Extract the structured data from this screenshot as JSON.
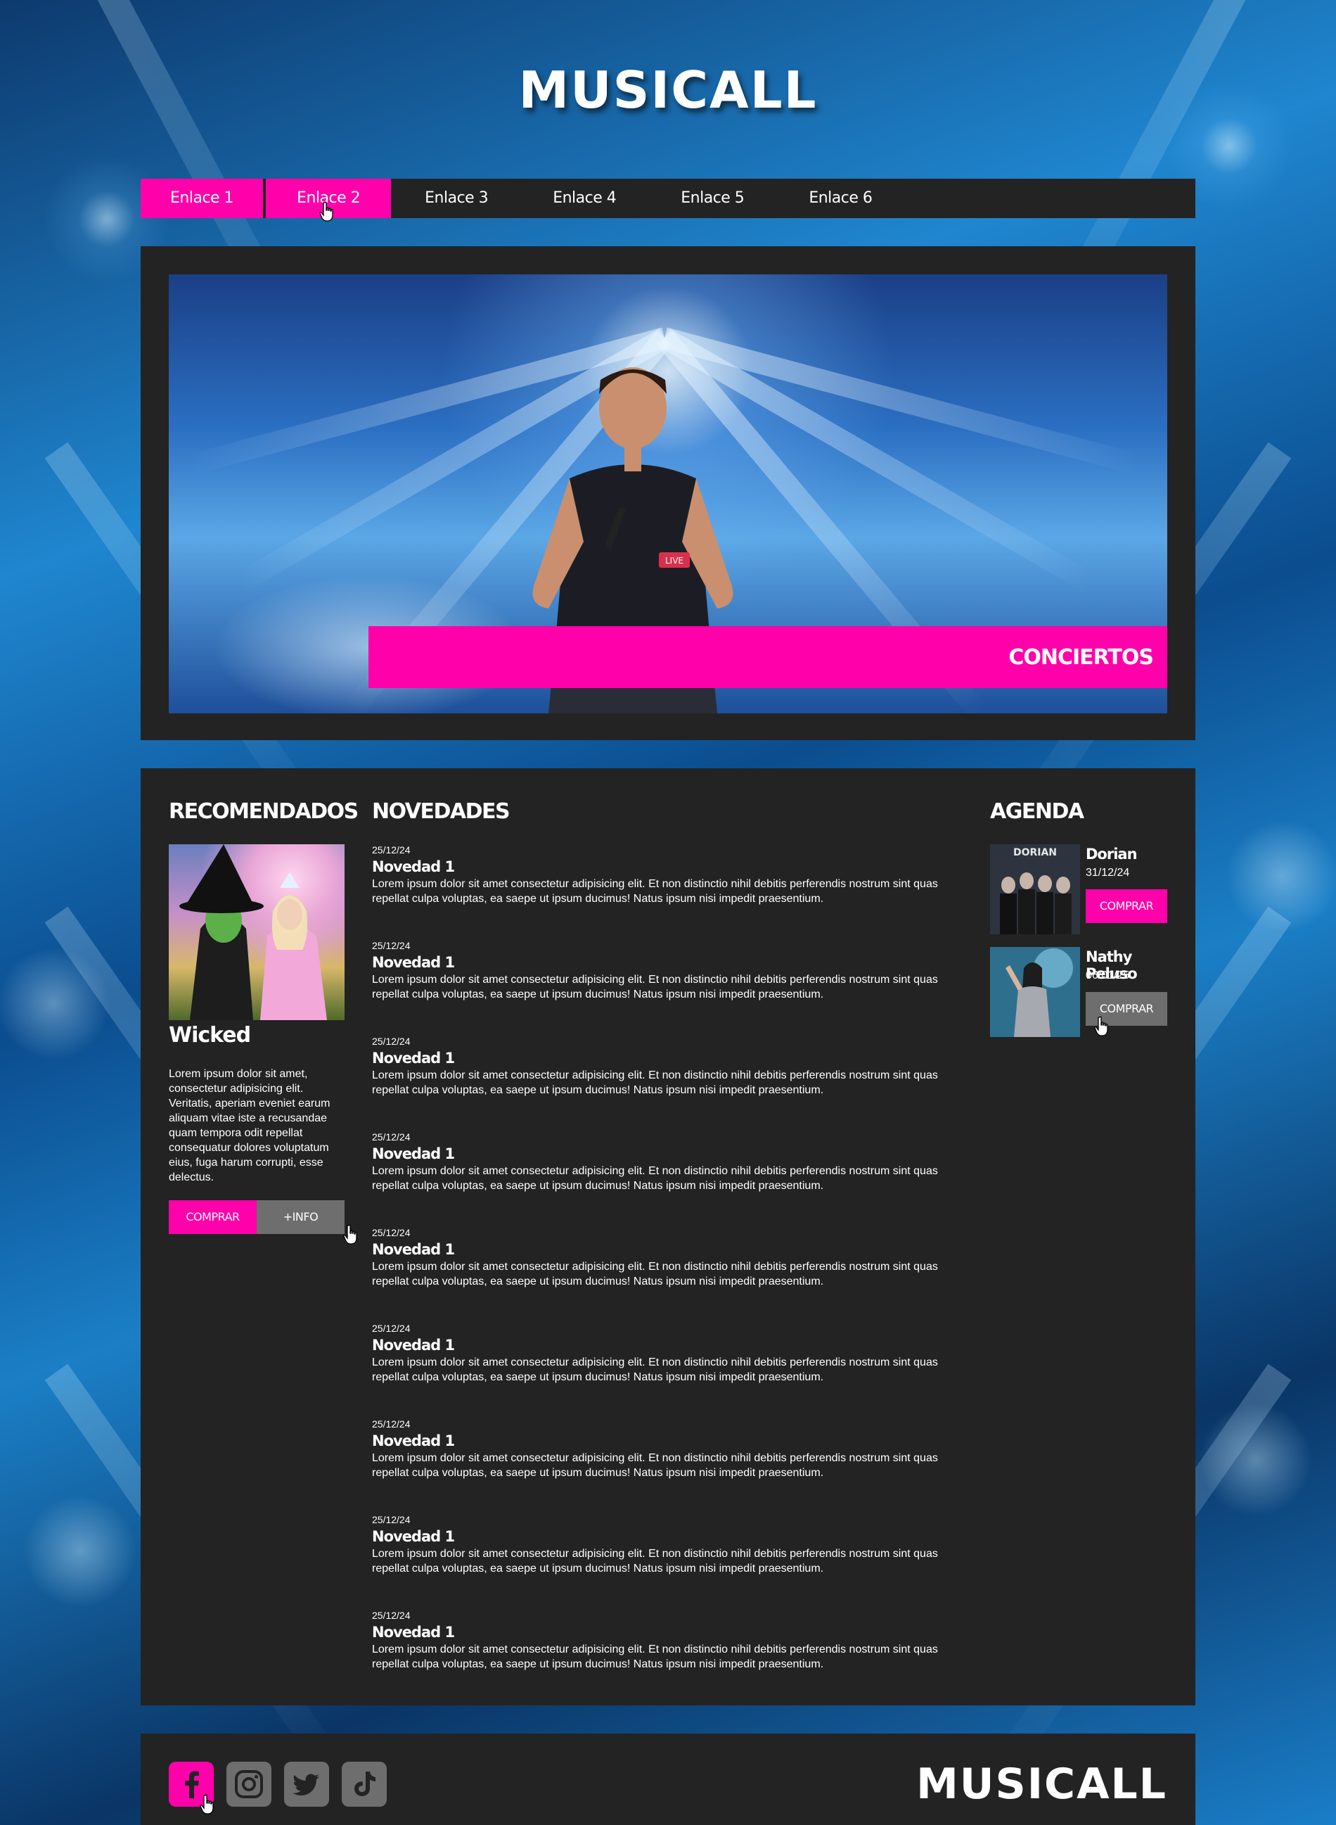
{
  "site": {
    "logo": "MUSICALL"
  },
  "nav": {
    "items": [
      {
        "label": "Enlace 1"
      },
      {
        "label": "Enlace 2"
      },
      {
        "label": "Enlace 3"
      },
      {
        "label": "Enlace 4"
      },
      {
        "label": "Enlace 5"
      },
      {
        "label": "Enlace 6"
      }
    ]
  },
  "hero": {
    "banner_label": "CONCIERTOS",
    "sign_text": "LIVE"
  },
  "recomendados": {
    "title": "RECOMENDADOS",
    "item": {
      "title": "Wicked",
      "description": "Lorem ipsum dolor sit amet, consectetur adipisicing elit. Veritatis, aperiam eveniet earum aliquam vitae iste a recusandae quam tempora odit repellat consequatur dolores voluptatum eius, fuga harum corrupti, esse delectus.",
      "buy_label": "COMPRAR",
      "info_label": "+INFO"
    }
  },
  "novedades": {
    "title": "NOVEDADES",
    "items": [
      {
        "date": "25/12/24",
        "title": "Novedad 1",
        "body": "Lorem ipsum dolor sit amet consectetur adipisicing elit. Et non distinctio nihil debitis perferendis nostrum sint quas repellat culpa voluptas, ea saepe ut ipsum ducimus! Natus ipsum nisi impedit praesentium."
      },
      {
        "date": "25/12/24",
        "title": "Novedad 1",
        "body": "Lorem ipsum dolor sit amet consectetur adipisicing elit. Et non distinctio nihil debitis perferendis nostrum sint quas repellat culpa voluptas, ea saepe ut ipsum ducimus! Natus ipsum nisi impedit praesentium."
      },
      {
        "date": "25/12/24",
        "title": "Novedad 1",
        "body": "Lorem ipsum dolor sit amet consectetur adipisicing elit. Et non distinctio nihil debitis perferendis nostrum sint quas repellat culpa voluptas, ea saepe ut ipsum ducimus! Natus ipsum nisi impedit praesentium."
      },
      {
        "date": "25/12/24",
        "title": "Novedad 1",
        "body": "Lorem ipsum dolor sit amet consectetur adipisicing elit. Et non distinctio nihil debitis perferendis nostrum sint quas repellat culpa voluptas, ea saepe ut ipsum ducimus! Natus ipsum nisi impedit praesentium."
      },
      {
        "date": "25/12/24",
        "title": "Novedad 1",
        "body": "Lorem ipsum dolor sit amet consectetur adipisicing elit. Et non distinctio nihil debitis perferendis nostrum sint quas repellat culpa voluptas, ea saepe ut ipsum ducimus! Natus ipsum nisi impedit praesentium."
      },
      {
        "date": "25/12/24",
        "title": "Novedad 1",
        "body": "Lorem ipsum dolor sit amet consectetur adipisicing elit. Et non distinctio nihil debitis perferendis nostrum sint quas repellat culpa voluptas, ea saepe ut ipsum ducimus! Natus ipsum nisi impedit praesentium."
      },
      {
        "date": "25/12/24",
        "title": "Novedad 1",
        "body": "Lorem ipsum dolor sit amet consectetur adipisicing elit. Et non distinctio nihil debitis perferendis nostrum sint quas repellat culpa voluptas, ea saepe ut ipsum ducimus! Natus ipsum nisi impedit praesentium."
      },
      {
        "date": "25/12/24",
        "title": "Novedad 1",
        "body": "Lorem ipsum dolor sit amet consectetur adipisicing elit. Et non distinctio nihil debitis perferendis nostrum sint quas repellat culpa voluptas, ea saepe ut ipsum ducimus! Natus ipsum nisi impedit praesentium."
      },
      {
        "date": "25/12/24",
        "title": "Novedad 1",
        "body": "Lorem ipsum dolor sit amet consectetur adipisicing elit. Et non distinctio nihil debitis perferendis nostrum sint quas repellat culpa voluptas, ea saepe ut ipsum ducimus! Natus ipsum nisi impedit praesentium."
      }
    ]
  },
  "agenda": {
    "title": "AGENDA",
    "items": [
      {
        "name": "Dorian",
        "date": "31/12/24",
        "buy_label": "COMPRAR",
        "thumb_text": "DORIAN"
      },
      {
        "name": "Nathy Peluso",
        "date": "06/01/25",
        "buy_label": "COMPRAR"
      }
    ]
  },
  "footer": {
    "logo": "MUSICALL",
    "social": [
      {
        "icon": "facebook-icon"
      },
      {
        "icon": "instagram-icon"
      },
      {
        "icon": "twitter-icon"
      },
      {
        "icon": "tiktok-icon"
      }
    ]
  },
  "colors": {
    "accent": "#ff00aa",
    "panel": "#232323",
    "button_gray": "#6e6e6e"
  }
}
